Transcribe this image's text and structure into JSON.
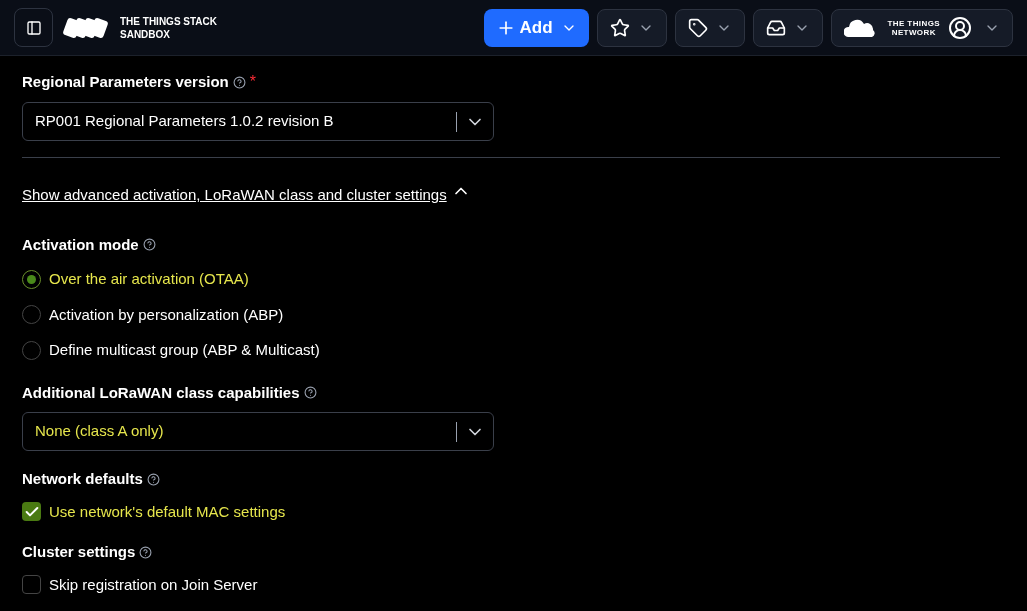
{
  "header": {
    "brand_lines": [
      "THE THINGS STACK",
      "SANDBOX"
    ],
    "add_button": "Add",
    "network_lines": [
      "THE THINGS",
      "NETWORK"
    ]
  },
  "regional": {
    "label": "Regional Parameters version",
    "required": true,
    "required_mark": "*",
    "value": "RP001 Regional Parameters 1.0.2 revision B",
    "highlighted": false
  },
  "advanced_link": {
    "label": "Show advanced activation, LoRaWAN class and cluster settings",
    "expanded": true
  },
  "activation": {
    "label": "Activation mode",
    "options": [
      {
        "label": "Over the air activation (OTAA)",
        "selected": true
      },
      {
        "label": "Activation by personalization (ABP)",
        "selected": false
      },
      {
        "label": "Define multicast group (ABP & Multicast)",
        "selected": false
      }
    ]
  },
  "class_caps": {
    "label": "Additional LoRaWAN class capabilities",
    "value": "None (class A only)",
    "highlighted": true
  },
  "network_defaults": {
    "label": "Network defaults",
    "checkbox": {
      "label": "Use network's default MAC settings",
      "checked": true
    }
  },
  "cluster": {
    "label": "Cluster settings",
    "checkbox": {
      "label": "Skip registration on Join Server",
      "checked": false
    }
  }
}
